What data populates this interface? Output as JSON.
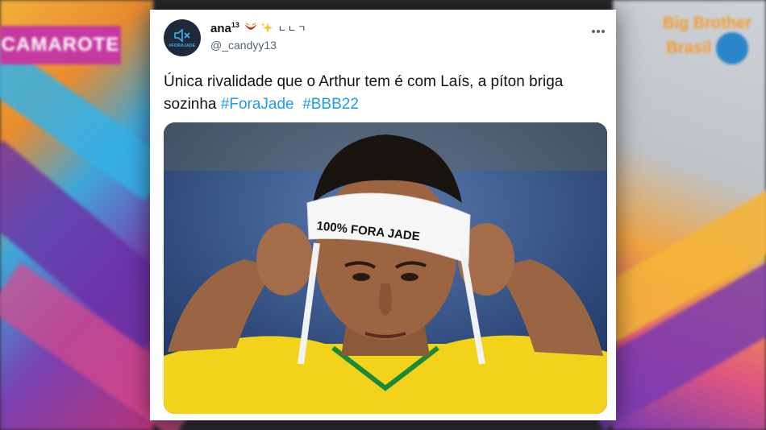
{
  "background": {
    "left_banner": "CAMAROTE",
    "right_logo": "Big Brother Brasil"
  },
  "tweet": {
    "display_name": "ana",
    "name_superscript": "13",
    "name_suffix": "ㄴㄴㄱ",
    "handle": "@_candyy13",
    "avatar_text": "#FORAJADE",
    "text_plain": "Única rivalidade que o Arthur tem é com Laís, a píton briga sozinha ",
    "hashtags": [
      "#ForaJade",
      "#BBB22"
    ],
    "headband_text": "100% FORA JADE"
  },
  "colors": {
    "link": "#1d9bf0",
    "text": "#0f1419",
    "muted": "#536471",
    "jersey": "#f2d21a"
  },
  "icons": [
    "muted-speaker-icon",
    "laughing-face-emoji",
    "sparkles-emoji",
    "more-options-icon"
  ]
}
